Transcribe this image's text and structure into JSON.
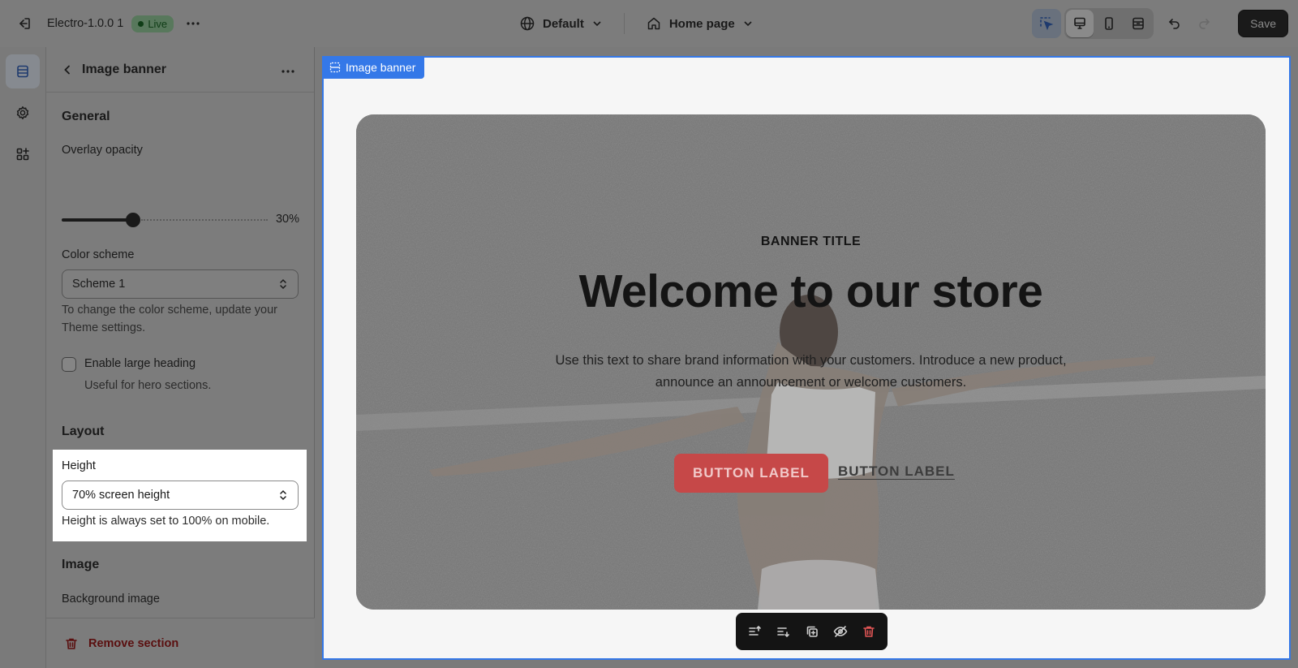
{
  "topbar": {
    "theme_name": "Electro-1.0.0 1",
    "live_label": "Live",
    "theme_selector": "Default",
    "page_selector": "Home page",
    "save_label": "Save"
  },
  "sidebar": {
    "title": "Image banner",
    "general": {
      "heading": "General",
      "overlay_label": "Overlay opacity",
      "overlay_value": "30%",
      "overlay_fraction": 0.3,
      "color_scheme_label": "Color scheme",
      "color_scheme_value": "Scheme 1",
      "color_scheme_help": "To change the color scheme, update your Theme settings.",
      "large_heading_label": "Enable large heading",
      "large_heading_help": "Useful for hero sections.",
      "large_heading_checked": false
    },
    "layout": {
      "heading": "Layout",
      "height_label": "Height",
      "height_value": "70% screen height",
      "height_help": "Height is always set to 100% on mobile."
    },
    "image": {
      "heading": "Image",
      "background_label": "Background image"
    },
    "remove_label": "Remove section"
  },
  "preview": {
    "section_tag": "Image banner",
    "banner": {
      "kicker": "BANNER TITLE",
      "heading": "Welcome to our store",
      "text": "Use this text to share brand information with your customers. Introduce a new product, announce an announcement or welcome customers.",
      "button_primary": "BUTTON LABEL",
      "button_secondary": "BUTTON LABEL"
    }
  },
  "colors": {
    "accent": "#3478e8",
    "primary_button": "#c64848",
    "live_badge": "#58785c",
    "remove": "#5a0f0f"
  }
}
